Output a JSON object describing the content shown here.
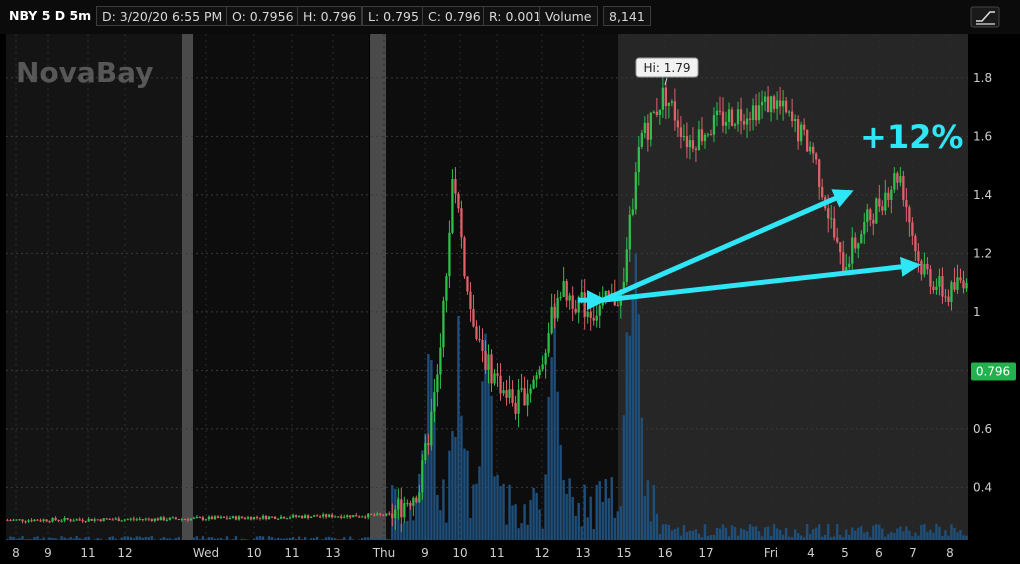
{
  "header": {
    "symbol": "NBY 5 D 5m",
    "date": "D: 3/20/20 6:55 PM",
    "open": "O: 0.7956",
    "high": "H: 0.796",
    "low": "L: 0.795",
    "close": "C: 0.796",
    "range": "R: 0.001",
    "volume_label": "Volume",
    "volume_value": "8,141"
  },
  "watermark": "NovaBay",
  "colors": {
    "up": "#2fbf4a",
    "down": "#e0606a",
    "volume": "#1f4e79",
    "arrow": "#2ee6f5",
    "last_price_bg": "#22b14c",
    "grid": "#3a3a3a"
  },
  "icons": {
    "settings": "chart-settings-icon"
  },
  "chart_data": {
    "type": "candlestick",
    "ylim": [
      0.22,
      1.95
    ],
    "y_ticks": [
      0.4,
      0.6,
      0.8,
      1.0,
      1.2,
      1.4,
      1.6,
      1.8
    ],
    "y_tick_labels": [
      "0.4",
      "0.6",
      "0.8",
      "1",
      "1.2",
      "1.4",
      "1.6",
      "1.8"
    ],
    "x_tick_labels": [
      "8",
      "9",
      "11",
      "12",
      "Wed",
      "10",
      "11",
      "13",
      "Thu",
      "9",
      "10",
      "11",
      "12",
      "13",
      "15",
      "16",
      "17",
      "Fri",
      "4",
      "5",
      "6",
      "7",
      "8"
    ],
    "high_label": "Hi: 1.79",
    "last_price": "0.796",
    "annotation": "+12%",
    "price_path": [
      {
        "t": 0.0,
        "p": 0.288
      },
      {
        "t": 0.18,
        "p": 0.292
      },
      {
        "t": 0.3,
        "p": 0.3
      },
      {
        "t": 0.4,
        "p": 0.305
      },
      {
        "t": 0.43,
        "p": 0.4
      },
      {
        "t": 0.45,
        "p": 0.8
      },
      {
        "t": 0.465,
        "p": 1.5
      },
      {
        "t": 0.48,
        "p": 1.05
      },
      {
        "t": 0.5,
        "p": 0.82
      },
      {
        "t": 0.53,
        "p": 0.68
      },
      {
        "t": 0.555,
        "p": 0.8
      },
      {
        "t": 0.575,
        "p": 1.08
      },
      {
        "t": 0.61,
        "p": 1.0
      },
      {
        "t": 0.64,
        "p": 1.06
      },
      {
        "t": 0.66,
        "p": 1.58
      },
      {
        "t": 0.685,
        "p": 1.75
      },
      {
        "t": 0.71,
        "p": 1.58
      },
      {
        "t": 0.745,
        "p": 1.66
      },
      {
        "t": 0.8,
        "p": 1.72
      },
      {
        "t": 0.84,
        "p": 1.55
      },
      {
        "t": 0.87,
        "p": 1.15
      },
      {
        "t": 0.9,
        "p": 1.33
      },
      {
        "t": 0.93,
        "p": 1.48
      },
      {
        "t": 0.95,
        "p": 1.17
      },
      {
        "t": 0.98,
        "p": 1.05
      },
      {
        "t": 1.0,
        "p": 1.13
      }
    ],
    "volume_peaks": [
      0.44,
      0.47,
      0.5,
      0.57,
      0.65,
      0.655
    ]
  }
}
